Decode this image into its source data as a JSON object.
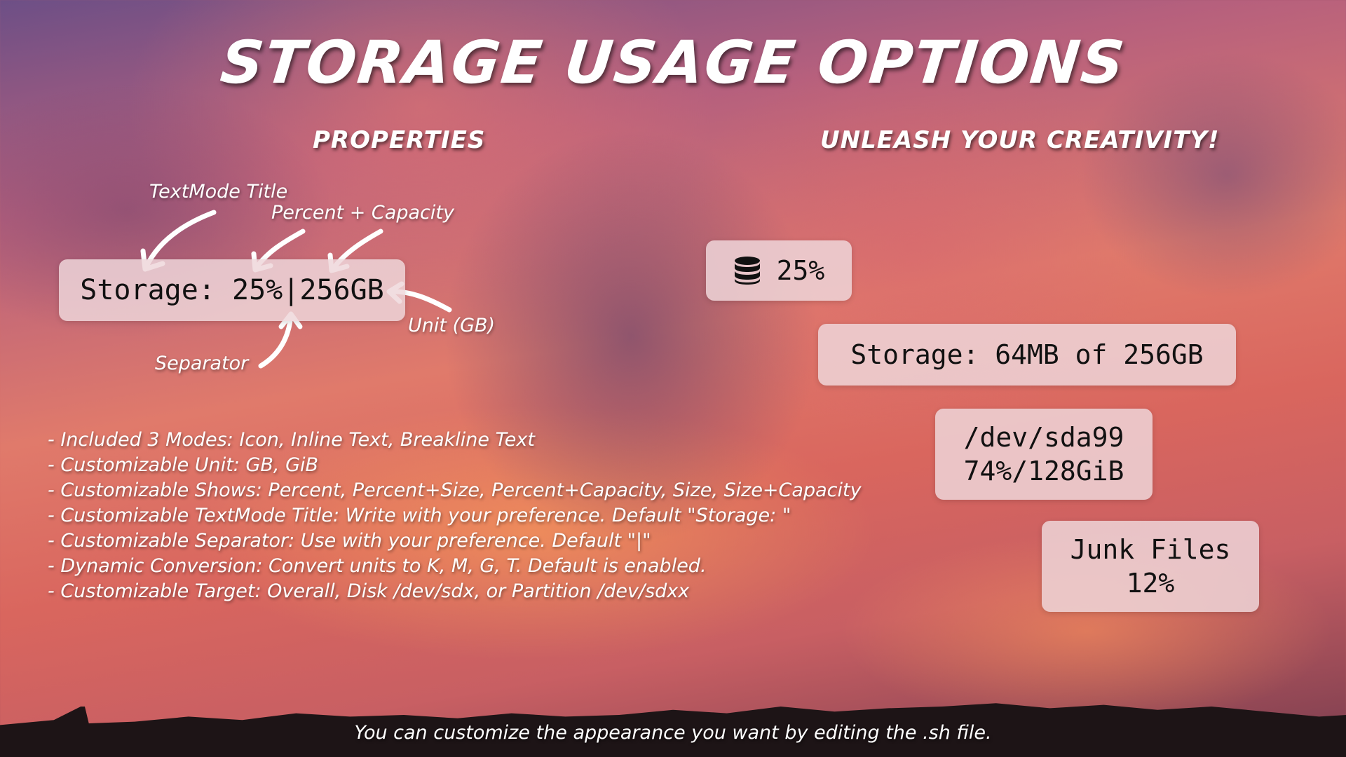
{
  "page": {
    "title": "Storage Usage Options",
    "left_heading": "Properties",
    "right_heading": "Unleash your creativity!",
    "footer": "You can customize the appearance you want by editing the .sh file."
  },
  "properties": {
    "example_text": "Storage: 25%|256GB",
    "annotations": {
      "textmode_title": "TextMode Title",
      "percent_capacity": "Percent + Capacity",
      "unit": "Unit (GB)",
      "separator": "Separator"
    }
  },
  "features": [
    "- Included 3 Modes: Icon, Inline Text, Breakline Text",
    "- Customizable Unit: GB, GiB",
    "- Customizable Shows: Percent, Percent+Size, Percent+Capacity, Size, Size+Capacity",
    "- Customizable TextMode Title: Write with your preference. Default \"Storage: \"",
    "- Customizable Separator: Use with your preference. Default \"|\"",
    "- Dynamic Conversion: Convert units to K, M, G, T. Default is enabled.",
    "- Customizable Target: Overall, Disk /dev/sdx, or Partition /dev/sdxx"
  ],
  "examples": {
    "icon_mode": {
      "icon": "database-icon",
      "text": "25%"
    },
    "inline_mode": {
      "text": "Storage: 64MB of 256GB"
    },
    "breakline_1": {
      "line1": "/dev/sda99",
      "line2": "74%/128GiB"
    },
    "breakline_2": {
      "line1": "Junk Files",
      "line2": "12%"
    }
  }
}
